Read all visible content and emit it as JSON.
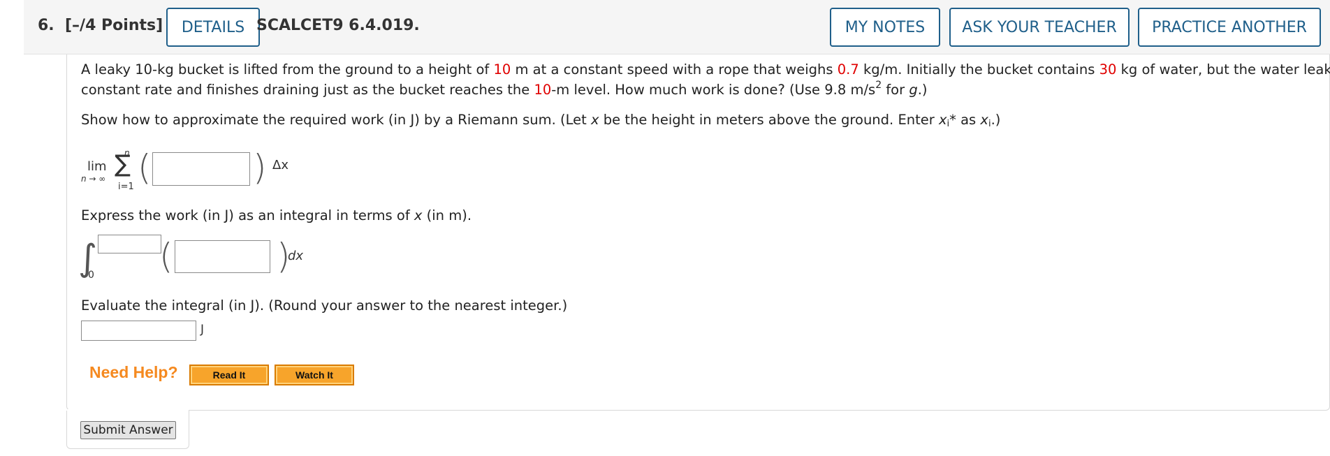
{
  "header": {
    "question_number": "6.",
    "points": "[–/4 Points]",
    "details_label": "DETAILS",
    "question_code": "SCALCET9 6.4.019.",
    "my_notes_label": "MY NOTES",
    "ask_teacher_label": "ASK YOUR TEACHER",
    "practice_label": "PRACTICE ANOTHER"
  },
  "problem": {
    "p1_a": "A leaky 10-kg bucket is lifted from the ground to a height of ",
    "height": "10",
    "p1_b": " m at a constant speed with a rope that weighs ",
    "rope_weight": "0.7",
    "p1_c": " kg/m. Initially the bucket contains ",
    "water_mass": "30",
    "p1_d": " kg of water, but the water leaks at a",
    "p2_a": "constant rate and finishes draining just as the bucket reaches the ",
    "level": "10",
    "p2_b": "-m level. How much work is done? (Use 9.8 m/s",
    "p2_sup": "2",
    "p2_c": " for ",
    "p2_g": "g",
    "p2_d": ".)",
    "riemann_a": "Show how to approximate the required work (in J) by a Riemann sum. (Let ",
    "riemann_x": "x",
    "riemann_b": " be the height in meters above the ground. Enter ",
    "riemann_xi": "x",
    "riemann_sub_i": "i",
    "riemann_star": "*",
    "riemann_c": " as ",
    "riemann_xi2": "x",
    "riemann_sub_i2": "i",
    "riemann_d": ".)",
    "integral_a": "Express the work (in J) as an integral in terms of ",
    "integral_x": "x",
    "integral_b": " (in m).",
    "evaluate": "Evaluate the integral (in J). (Round your answer to the nearest integer.)"
  },
  "math": {
    "lim": "lim",
    "lim_sub": "n → ∞",
    "sum_upper": "n",
    "sum_lower": "i=1",
    "delta_x": "Δx",
    "integral_lower": "0",
    "dx": "dx",
    "unit_J": "J"
  },
  "answers": {
    "riemann_value": "",
    "upper_limit_value": "",
    "integrand_value": "",
    "work_value": ""
  },
  "help": {
    "label": "Need Help?",
    "read_it": "Read It",
    "watch_it": "Watch It"
  },
  "submit_label": "Submit Answer",
  "colors": {
    "accent_blue": "#1f5f8a",
    "red_values": "#e00000",
    "help_orange": "#f5891f"
  }
}
